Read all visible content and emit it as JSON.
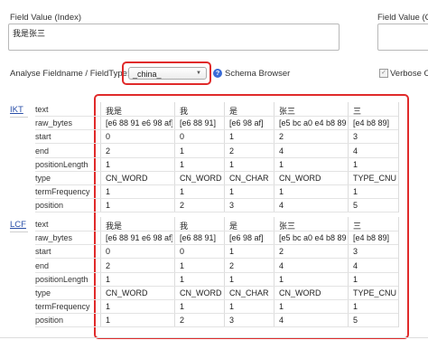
{
  "field_value": {
    "label": "Field Value (Index)",
    "value": "我是张三"
  },
  "field_value_query": {
    "label": "Field Value (Q"
  },
  "analyse": {
    "label": "Analyse Fieldname / FieldType:",
    "selected": "_china_",
    "schema_browser": "Schema Browser",
    "verbose_label": "Verbose O",
    "help_glyph": "?"
  },
  "row_labels": [
    "text",
    "raw_bytes",
    "start",
    "end",
    "positionLength",
    "type",
    "termFrequency",
    "position"
  ],
  "sections": [
    {
      "name": "IKT",
      "tokens": [
        {
          "text": "我是",
          "raw_bytes": "[e6 88 91 e6 98 af]",
          "start": "0",
          "end": "2",
          "positionLength": "1",
          "type": "CN_WORD",
          "termFrequency": "1",
          "position": "1"
        },
        {
          "text": "我",
          "raw_bytes": "[e6 88 91]",
          "start": "0",
          "end": "1",
          "positionLength": "1",
          "type": "CN_WORD",
          "termFrequency": "1",
          "position": "2"
        },
        {
          "text": "是",
          "raw_bytes": "[e6 98 af]",
          "start": "1",
          "end": "2",
          "positionLength": "1",
          "type": "CN_CHAR",
          "termFrequency": "1",
          "position": "3"
        },
        {
          "text": "张三",
          "raw_bytes": "[e5 bc a0 e4 b8 89]",
          "start": "2",
          "end": "4",
          "positionLength": "1",
          "type": "CN_WORD",
          "termFrequency": "1",
          "position": "4"
        },
        {
          "text": "三",
          "raw_bytes": "[e4 b8 89]",
          "start": "3",
          "end": "4",
          "positionLength": "1",
          "type": "TYPE_CNUM",
          "termFrequency": "1",
          "position": "5"
        }
      ]
    },
    {
      "name": "LCF",
      "tokens": [
        {
          "text": "我是",
          "raw_bytes": "[e6 88 91 e6 98 af]",
          "start": "0",
          "end": "2",
          "positionLength": "1",
          "type": "CN_WORD",
          "termFrequency": "1",
          "position": "1"
        },
        {
          "text": "我",
          "raw_bytes": "[e6 88 91]",
          "start": "0",
          "end": "1",
          "positionLength": "1",
          "type": "CN_WORD",
          "termFrequency": "1",
          "position": "2"
        },
        {
          "text": "是",
          "raw_bytes": "[e6 98 af]",
          "start": "1",
          "end": "2",
          "positionLength": "1",
          "type": "CN_CHAR",
          "termFrequency": "1",
          "position": "3"
        },
        {
          "text": "张三",
          "raw_bytes": "[e5 bc a0 e4 b8 89]",
          "start": "2",
          "end": "4",
          "positionLength": "1",
          "type": "CN_WORD",
          "termFrequency": "1",
          "position": "4"
        },
        {
          "text": "三",
          "raw_bytes": "[e4 b8 89]",
          "start": "3",
          "end": "4",
          "positionLength": "1",
          "type": "TYPE_CNUM",
          "termFrequency": "1",
          "position": "5"
        }
      ]
    }
  ],
  "colors": {
    "highlight": "#e02a2a",
    "link": "#2a4fa8",
    "help_icon": "#3a6bd6"
  }
}
